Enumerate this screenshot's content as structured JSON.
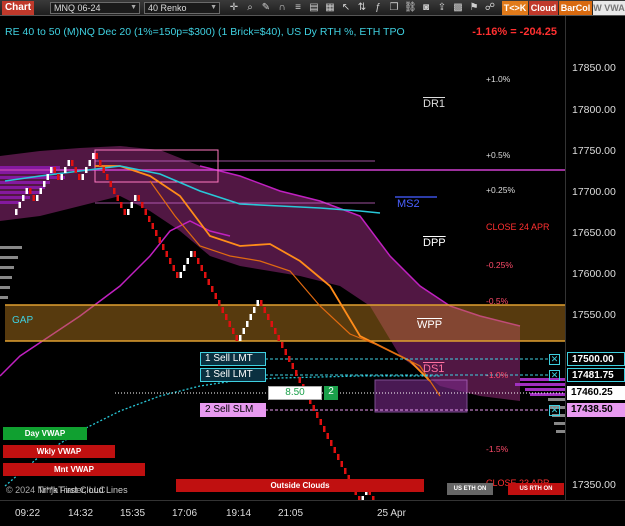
{
  "toolbar": {
    "title": "Chart",
    "instrument": "MNQ 06-24",
    "bar_type": "40 Renko",
    "tk_label": "T<>K",
    "cloud_label": "Cloud",
    "barcol_label": "BarCol",
    "wvwa_label": "W VWA",
    "icons": [
      "crosshair-icon",
      "zoom-icon",
      "draw-icon",
      "magnet-icon",
      "properties-icon",
      "template-icon",
      "layout-icon",
      "cursor-icon",
      "chart-trader-icon",
      "strategy-icon",
      "window-icon",
      "link-icon",
      "snapshot-icon",
      "share-icon",
      "grid-icon",
      "alert-icon",
      "instrument-link-icon"
    ]
  },
  "chart": {
    "header": "RE 40 to 50 (M)NQ Dec 20 (1%=150p=$300) (1 Brick=$40), US Dy RTH %, ETH TPO",
    "change": "-1.16% = -204.25",
    "watermark": "© 2024 NinjaTrader, LLC",
    "watermark2": "Tr**k First Cloud Lines",
    "colors": {
      "background": "#000000",
      "up_brick": "#ffffff",
      "down_brick": "#e01010",
      "cloud": "#5a1a4a",
      "gap": "#c08020",
      "vwap": "#28c8d8"
    }
  },
  "levels": {
    "dr1": "DR1",
    "ms2": "MS2",
    "dpp": "DPP",
    "wpp": "WPP",
    "ds1": "DS1",
    "gap": "GAP",
    "close_24_apr": "CLOSE 24 APR",
    "close_23_apr": "CLOSE 23 APR"
  },
  "pct_levels": [
    {
      "label": "+1.0%",
      "color": "#dddddd"
    },
    {
      "label": "+0.5%",
      "color": "#dddddd"
    },
    {
      "label": "+0.25%",
      "color": "#dddddd"
    },
    {
      "label": "-0.25%",
      "color": "#ff4b6a"
    },
    {
      "label": "-0.5%",
      "color": "#ff4b6a"
    },
    {
      "label": "-1.0%",
      "color": "#ff4b6a"
    },
    {
      "label": "-1.5%",
      "color": "#ff4b6a"
    }
  ],
  "orders": {
    "sell_lmt_1": "1 Sell LMT",
    "sell_lmt_2": "1 Sell LMT",
    "sell_slm": "2 Sell SLM",
    "position_price": "8.50",
    "position_qty": "2"
  },
  "legend": {
    "day_vwap": "Day VWAP",
    "wkly_vwap": "Wkly VWAP",
    "mnt_vwap": "Mnt VWAP",
    "outside_clouds": "Outside Clouds",
    "us_eth_on": "US ETH ON",
    "us_rth_on": "US RTH ON"
  },
  "price_axis": {
    "labels": [
      "17850.00",
      "17800.00",
      "17750.00",
      "17700.00",
      "17650.00",
      "17600.00",
      "17550.00",
      "17350.00"
    ],
    "tags": [
      {
        "value": "17500.00",
        "bg": "#000000",
        "fg": "#ffffff",
        "border": "#3fd0e0"
      },
      {
        "value": "17481.75",
        "bg": "#000000",
        "fg": "#ffffff",
        "border": "#3fd0e0"
      },
      {
        "value": "17460.25",
        "bg": "#ffffff",
        "fg": "#000000",
        "border": "#ffffff"
      },
      {
        "value": "17438.50",
        "bg": "#e89af0",
        "fg": "#000000",
        "border": "#e89af0"
      }
    ]
  },
  "time_axis": [
    "09:22",
    "14:32",
    "15:35",
    "17:06",
    "19:14",
    "21:05",
    "25 Apr"
  ]
}
